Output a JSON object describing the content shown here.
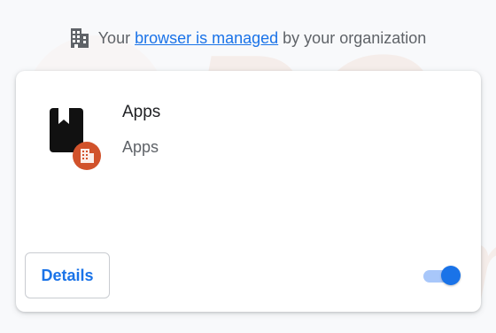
{
  "managed_notice": {
    "prefix": "Your",
    "link_text": "browser is managed",
    "suffix": "by your organization",
    "icon": "building-icon"
  },
  "extension": {
    "name": "Apps",
    "description": "Apps",
    "icon": "apps-bookmark-icon",
    "badge_icon": "enterprise-badge-icon",
    "details_label": "Details",
    "enabled": true
  },
  "colors": {
    "accent": "#1a73e8",
    "badge": "#d1522b",
    "text_secondary": "#5f6368"
  }
}
